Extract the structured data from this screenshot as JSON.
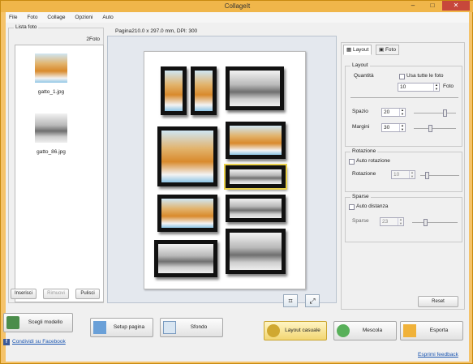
{
  "window": {
    "title": "CollageIt",
    "min": "–",
    "max": "□",
    "close": "✕"
  },
  "menu": [
    "File",
    "Foto",
    "Collage",
    "Opzioni",
    "Auto"
  ],
  "photo_list": {
    "group_label": "Lista foto",
    "count": "2Foto",
    "items": [
      {
        "name": "gatto_1.jpg",
        "thumb": "cat-orange"
      },
      {
        "name": "gatto_86.jpg",
        "thumb": "cat-gray"
      }
    ],
    "insert_label": "Inserisci",
    "remove_label": "Rimuovi",
    "clear_label": "Pulisci"
  },
  "canvas": {
    "page_info": "Pagina210.0 x 297.0 mm, DPI: 300"
  },
  "right_panel": {
    "tab_layout": "Layout",
    "tab_photo": "Foto",
    "layout_group": "Layout",
    "quantity_label": "Quantità",
    "use_all_label": "Usa tutte le foto",
    "quantity_value": "10",
    "photo_unit": "Foto",
    "space_label": "Spazio",
    "space_value": "20",
    "margin_label": "Margini",
    "margin_value": "30",
    "rotation_group": "Rotazione",
    "auto_rotation_label": "Auto rotazione",
    "rotation_label": "Rotazione",
    "rotation_value": "10",
    "sparse_group": "Sparse",
    "auto_distance_label": "Auto distanza",
    "sparse_label": "Sparse",
    "sparse_value": "23",
    "reset_label": "Reset"
  },
  "bottom": {
    "choose_model": "Scegli modello",
    "page_setup": "Setup pagina",
    "background": "Sfondo",
    "random_layout": "Layout casuale",
    "shuffle": "Mescola",
    "export": "Esporta",
    "facebook": "Condividi su Facebook",
    "feedback": "Esprimi feedback"
  },
  "colors": {
    "accent": "#f0b64a",
    "selection": "#e8cf4a",
    "link": "#1a55b0"
  }
}
